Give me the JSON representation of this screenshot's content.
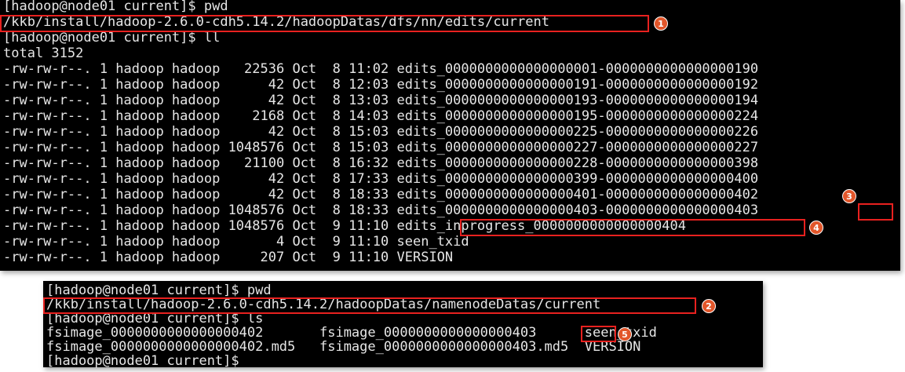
{
  "terminal1": {
    "lines": [
      "[hadoop@node01 current]$ pwd",
      "/kkb/install/hadoop-2.6.0-cdh5.14.2/hadoopDatas/dfs/nn/edits/current",
      "[hadoop@node01 current]$ ll",
      "total 3152",
      "-rw-rw-r--. 1 hadoop hadoop   22536 Oct  8 11:02 edits_0000000000000000001-0000000000000000190",
      "-rw-rw-r--. 1 hadoop hadoop      42 Oct  8 12:03 edits_0000000000000000191-0000000000000000192",
      "-rw-rw-r--. 1 hadoop hadoop      42 Oct  8 13:03 edits_0000000000000000193-0000000000000000194",
      "-rw-rw-r--. 1 hadoop hadoop    2168 Oct  8 14:03 edits_0000000000000000195-0000000000000000224",
      "-rw-rw-r--. 1 hadoop hadoop      42 Oct  8 15:03 edits_0000000000000000225-0000000000000000226",
      "-rw-rw-r--. 1 hadoop hadoop 1048576 Oct  8 15:03 edits_0000000000000000227-0000000000000000227",
      "-rw-rw-r--. 1 hadoop hadoop   21100 Oct  8 16:32 edits_0000000000000000228-0000000000000000398",
      "-rw-rw-r--. 1 hadoop hadoop      42 Oct  8 17:33 edits_0000000000000000399-0000000000000000400",
      "-rw-rw-r--. 1 hadoop hadoop      42 Oct  8 18:33 edits_0000000000000000401-0000000000000000402",
      "-rw-rw-r--. 1 hadoop hadoop 1048576 Oct  8 18:33 edits_0000000000000000403-0000000000000000403",
      "-rw-rw-r--. 1 hadoop hadoop 1048576 Oct  9 11:10 edits_inprogress_0000000000000000404",
      "-rw-rw-r--. 1 hadoop hadoop       4 Oct  9 11:10 seen_txid",
      "-rw-rw-r--. 1 hadoop hadoop     207 Oct  9 11:10 VERSION"
    ]
  },
  "terminal2": {
    "lines": [
      "[hadoop@node01 current]$ pwd",
      "/kkb/install/hadoop-2.6.0-cdh5.14.2/hadoopDatas/namenodeDatas/current",
      "[hadoop@node01 current]$ ls",
      "fsimage_0000000000000000402       fsimage_0000000000000000403      seen_txid",
      "fsimage_0000000000000000402.md5   fsimage_0000000000000000403.md5  VERSION",
      "[hadoop@node01 current]$"
    ]
  },
  "annotations": {
    "badge1": "1",
    "badge2": "2",
    "badge3": "3",
    "badge4": "4",
    "badge5": "5"
  },
  "colors": {
    "terminal_bg": "#000000",
    "terminal_fg": "#e6e6e6",
    "highlight": "#e8211f",
    "badge": "#e2562a"
  }
}
